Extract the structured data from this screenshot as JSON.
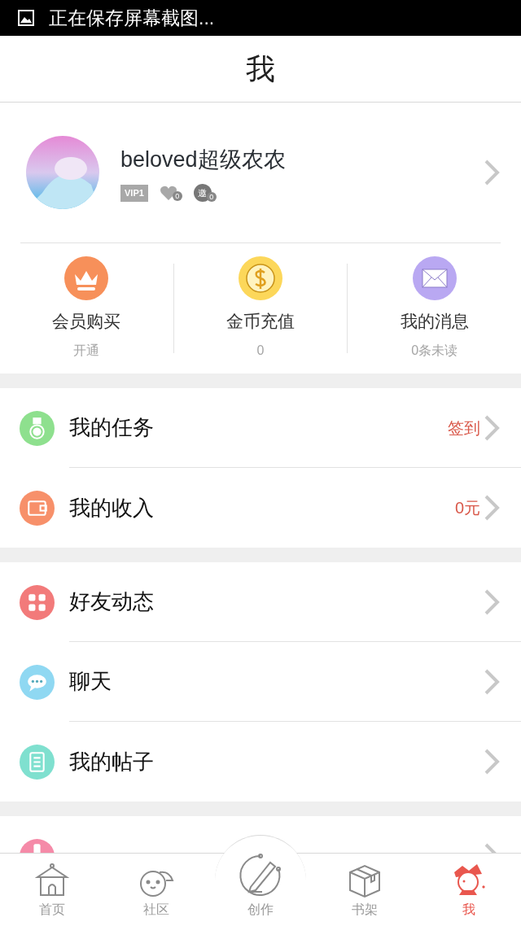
{
  "status_bar": {
    "text": "正在保存屏幕截图..."
  },
  "header": {
    "title": "我"
  },
  "profile": {
    "name": "beloved超级农农",
    "vip": "VIP1",
    "likes": "0",
    "invites_badge": "邀",
    "invites": "0"
  },
  "stats": [
    {
      "kind": "vip",
      "label": "会员购买",
      "sub": "开通"
    },
    {
      "kind": "coin",
      "label": "金币充值",
      "sub": "0"
    },
    {
      "kind": "mail",
      "label": "我的消息",
      "sub": "0条未读"
    }
  ],
  "groups": [
    [
      {
        "kind": "task",
        "label": "我的任务",
        "value": "签到"
      },
      {
        "kind": "income",
        "label": "我的收入",
        "value": "0元"
      }
    ],
    [
      {
        "kind": "friends",
        "label": "好友动态"
      },
      {
        "kind": "chat",
        "label": "聊天"
      },
      {
        "kind": "posts",
        "label": "我的帖子"
      }
    ],
    [
      {
        "kind": "help"
      }
    ]
  ],
  "tabs": [
    {
      "kind": "home",
      "label": "首页",
      "selected": false
    },
    {
      "kind": "community",
      "label": "社区",
      "selected": false
    },
    {
      "kind": "create",
      "label": "创作",
      "selected": false
    },
    {
      "kind": "shelf",
      "label": "书架",
      "selected": false
    },
    {
      "kind": "me",
      "label": "我",
      "selected": true
    }
  ]
}
